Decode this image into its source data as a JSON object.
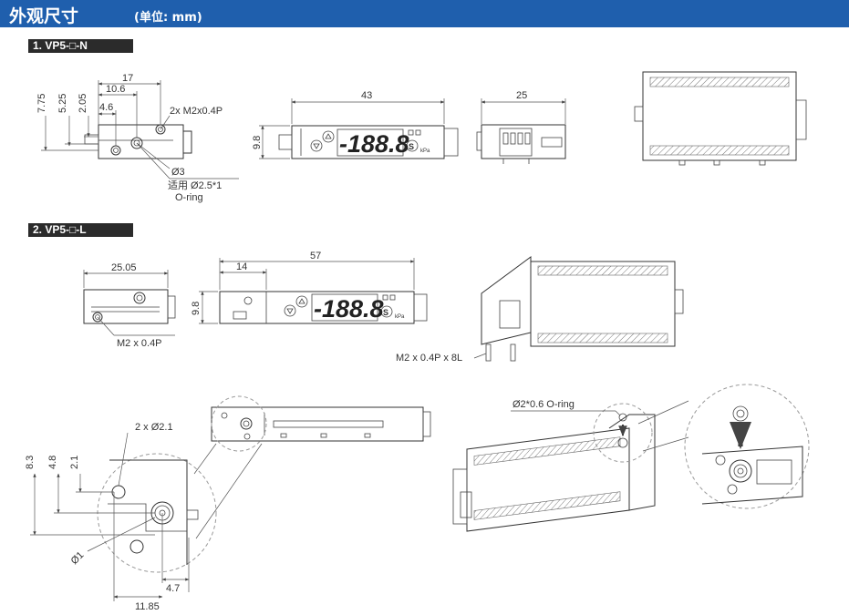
{
  "header": {
    "title": "外观尺寸",
    "unit": "(单位: mm)"
  },
  "sections": [
    {
      "label": "1. VP5-□-N"
    },
    {
      "label": "2. VP5-□-L"
    }
  ],
  "display": {
    "digits": "-188.8",
    "s_symbol": "S",
    "unit": "kPa"
  },
  "n_side": {
    "dims": [
      "7.75",
      "5.25",
      "2.05",
      "10.6",
      "17",
      "4.6"
    ],
    "callout_tap": "2x M2x0.4P",
    "callout_hole": "Ø3",
    "callout_oring_1": "适用 Ø2.5*1",
    "callout_oring_2": "O-ring"
  },
  "n_front": {
    "width": "43",
    "height": "9.8"
  },
  "n_back": {
    "width": "25"
  },
  "l_side": {
    "width": "25.05",
    "callout": "M2 x 0.4P"
  },
  "l_front": {
    "width": "57",
    "offset": "14",
    "height": "9.8"
  },
  "l_iso": {
    "callout": "M2 x 0.4P x 8L"
  },
  "detail": {
    "holes": "2 x Ø2.1",
    "dim_a": "8.3",
    "dim_b": "4.8",
    "dim_c": "2.1",
    "dia": "Ø1",
    "dim_d": "4.7",
    "dim_e": "11.85"
  },
  "oring_iso": {
    "callout": "Ø2*0.6 O-ring"
  }
}
